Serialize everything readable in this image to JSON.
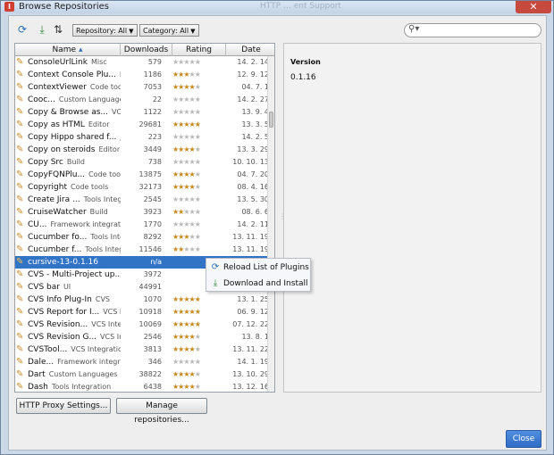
{
  "window": {
    "title": "Browse Repositories",
    "ghost_text": "HTTP … ent Support",
    "close_glyph": "✕"
  },
  "toolbar": {
    "refresh_icon": "refresh-icon",
    "install_icon": "download-icon",
    "sort_icon": "sort-icon",
    "repository_combo": "Repository: All",
    "category_combo": "Category: All",
    "search_placeholder": ""
  },
  "table": {
    "columns": [
      "Name",
      "Downloads",
      "Rating",
      "Date"
    ],
    "sort_indicator": "▴",
    "selected_index": 20,
    "rows": [
      {
        "name": "ConsoleUrlLink",
        "cat": "Misc",
        "dl": "579",
        "stars": 0,
        "date": "14. 2. 14"
      },
      {
        "name": "Context Console Plu...",
        "cat": "Mis",
        "dl": "1186",
        "stars": 3,
        "date": "12. 9. 12"
      },
      {
        "name": "ContextViewer",
        "cat": "Code tools",
        "dl": "7053",
        "stars": 3.5,
        "date": "04. 7. 1"
      },
      {
        "name": "Cooc...",
        "cat": "Custom Languages",
        "dl": "22",
        "stars": 0,
        "date": "14. 2. 27"
      },
      {
        "name": "Copy & Browse as...",
        "cat": "VCS",
        "dl": "1122",
        "stars": 0,
        "date": "13. 9. 4"
      },
      {
        "name": "Copy as HTML",
        "cat": "Editor",
        "dl": "29681",
        "stars": 4.5,
        "date": "13. 3. 5"
      },
      {
        "name": "Copy Hippo shared f...",
        "cat": "J2e",
        "dl": "223",
        "stars": 0,
        "date": "14. 2. 5"
      },
      {
        "name": "Copy on steroids",
        "cat": "Editor",
        "dl": "3449",
        "stars": 4,
        "date": "13. 3. 29"
      },
      {
        "name": "Copy Src",
        "cat": "Build",
        "dl": "738",
        "stars": 0,
        "date": "10. 10. 13"
      },
      {
        "name": "CopyFQNPlu...",
        "cat": "Code tool",
        "dl": "13875",
        "stars": 3.5,
        "date": "04. 7. 20"
      },
      {
        "name": "Copyright",
        "cat": "Code tools",
        "dl": "32173",
        "stars": 4,
        "date": "08. 4. 16"
      },
      {
        "name": "Create Jira ...",
        "cat": "Tools Integra",
        "dl": "2545",
        "stars": 0,
        "date": "13. 5. 30"
      },
      {
        "name": "CruiseWatcher",
        "cat": "Build",
        "dl": "3923",
        "stars": 2,
        "date": "08. 6. 6"
      },
      {
        "name": "CU...",
        "cat": "Framework integratio",
        "dl": "1770",
        "stars": 0,
        "date": "14. 2. 11"
      },
      {
        "name": "Cucumber fo...",
        "cat": "Tools Inte",
        "dl": "8292",
        "stars": 3,
        "date": "13. 11. 19"
      },
      {
        "name": "Cucumber f...",
        "cat": "Tools Integ",
        "dl": "11546",
        "stars": 2,
        "date": "13. 11. 19"
      },
      {
        "name": "cursive-13-0.1.16",
        "cat": "",
        "dl": "n/a",
        "stars": -1,
        "date": ""
      },
      {
        "name": "CVS - Multi-Project up...",
        "cat": "C",
        "dl": "3972",
        "stars": -1,
        "date": ""
      },
      {
        "name": "CVS bar",
        "cat": "UI",
        "dl": "44991",
        "stars": -1,
        "date": ""
      },
      {
        "name": "CVS Info Plug-In",
        "cat": "CVS",
        "dl": "1070",
        "stars": 4.5,
        "date": "13. 1. 25"
      },
      {
        "name": "CVS Report for I...",
        "cat": "VCS In",
        "dl": "10918",
        "stars": 4.5,
        "date": "06. 9. 12"
      },
      {
        "name": "CVS Revision...",
        "cat": "VCS Integr",
        "dl": "10069",
        "stars": 5,
        "date": "07. 12. 22"
      },
      {
        "name": "CVS Revision G...",
        "cat": "VCS Inte",
        "dl": "2546",
        "stars": 4,
        "date": "13. 8. 1"
      },
      {
        "name": "CVSTool...",
        "cat": "VCS Integratio",
        "dl": "3813",
        "stars": 4,
        "date": "13. 11. 22"
      },
      {
        "name": "Dale...",
        "cat": "Framework integrat",
        "dl": "346",
        "stars": 0,
        "date": "14. 1. 19"
      },
      {
        "name": "Dart",
        "cat": "Custom Languages",
        "dl": "38822",
        "stars": 4,
        "date": "13. 10. 29"
      },
      {
        "name": "Dash",
        "cat": "Tools Integration",
        "dl": "6438",
        "stars": 4,
        "date": "13. 12. 16"
      }
    ]
  },
  "detail": {
    "version_label": "Version",
    "version_value": "0.1.16"
  },
  "context_menu": {
    "items": [
      {
        "label": "Reload List of Plugins",
        "icon": "refresh-icon"
      },
      {
        "label": "Download and Install",
        "icon": "download-icon"
      }
    ]
  },
  "buttons": {
    "http_proxy": "HTTP Proxy Settings...",
    "manage_repos": "Manage repositories...",
    "close": "Close"
  },
  "colors": {
    "selection": "#3174c6",
    "star_on": "#c7871b",
    "star_off": "#b8b8b8",
    "close_button": "#3a78d0"
  }
}
